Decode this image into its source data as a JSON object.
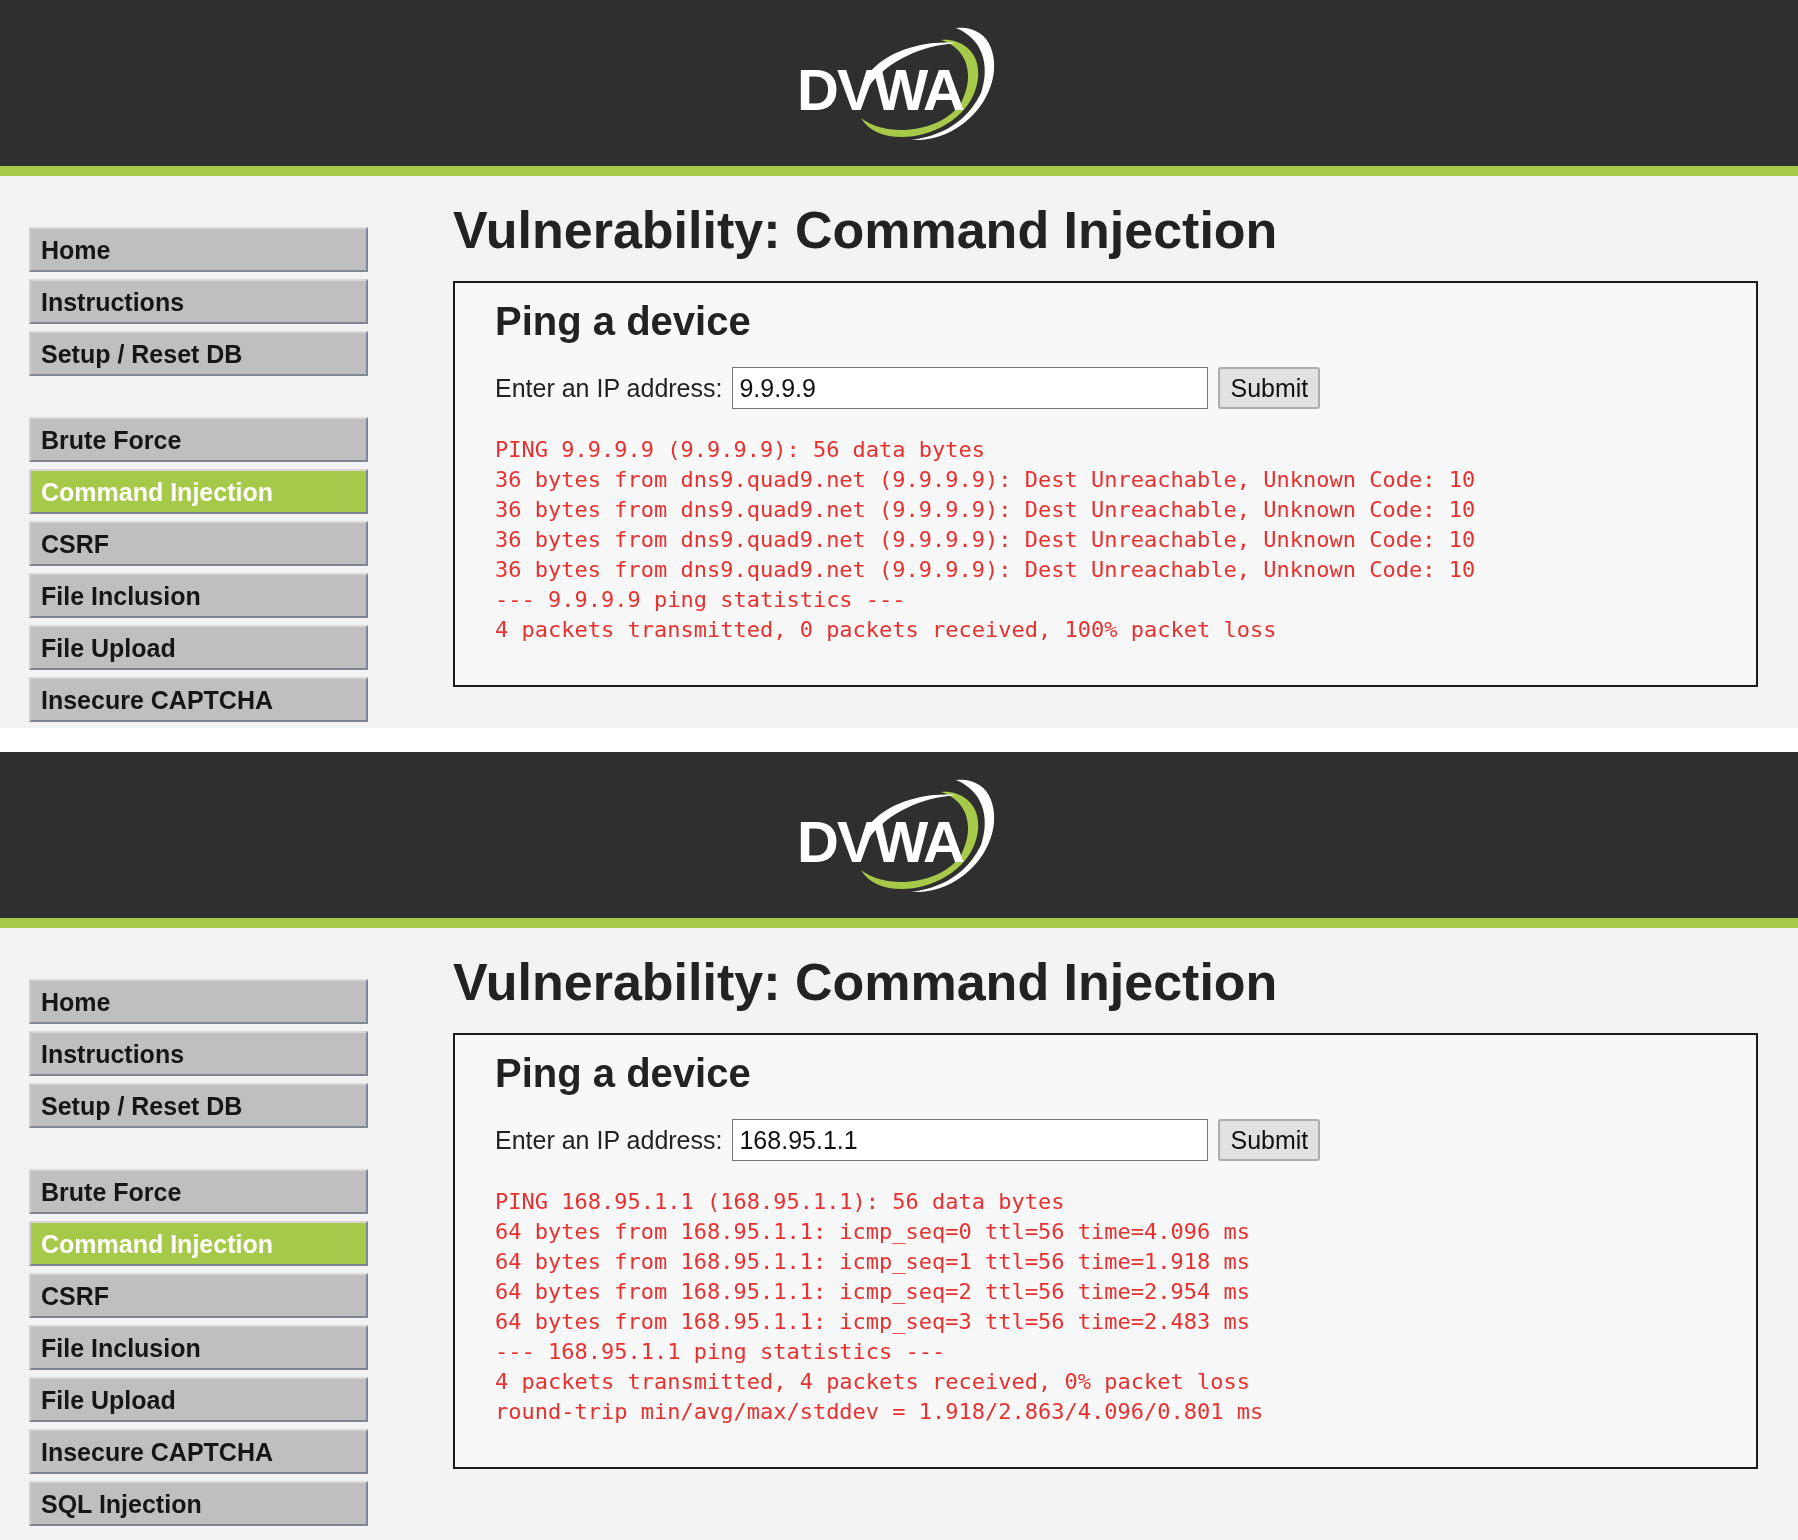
{
  "panels": [
    {
      "logo": "DVWA",
      "menu_groups": [
        [
          {
            "label": "Home",
            "selected": false
          },
          {
            "label": "Instructions",
            "selected": false
          },
          {
            "label": "Setup / Reset DB",
            "selected": false
          }
        ],
        [
          {
            "label": "Brute Force",
            "selected": false
          },
          {
            "label": "Command Injection",
            "selected": true
          },
          {
            "label": "CSRF",
            "selected": false
          },
          {
            "label": "File Inclusion",
            "selected": false
          },
          {
            "label": "File Upload",
            "selected": false
          },
          {
            "label": "Insecure CAPTCHA",
            "selected": false
          }
        ]
      ],
      "heading": "Vulnerability: Command Injection",
      "form": {
        "title": "Ping a device",
        "label": "Enter an IP address:",
        "value": "9.9.9.9",
        "button": "Submit"
      },
      "output": [
        "PING 9.9.9.9 (9.9.9.9): 56 data bytes",
        "36 bytes from dns9.quad9.net (9.9.9.9): Dest Unreachable, Unknown Code: 10",
        "36 bytes from dns9.quad9.net (9.9.9.9): Dest Unreachable, Unknown Code: 10",
        "36 bytes from dns9.quad9.net (9.9.9.9): Dest Unreachable, Unknown Code: 10",
        "36 bytes from dns9.quad9.net (9.9.9.9): Dest Unreachable, Unknown Code: 10",
        "--- 9.9.9.9 ping statistics ---",
        "4 packets transmitted, 0 packets received, 100% packet loss"
      ]
    },
    {
      "logo": "DVWA",
      "menu_groups": [
        [
          {
            "label": "Home",
            "selected": false
          },
          {
            "label": "Instructions",
            "selected": false
          },
          {
            "label": "Setup / Reset DB",
            "selected": false
          }
        ],
        [
          {
            "label": "Brute Force",
            "selected": false
          },
          {
            "label": "Command Injection",
            "selected": true
          },
          {
            "label": "CSRF",
            "selected": false
          },
          {
            "label": "File Inclusion",
            "selected": false
          },
          {
            "label": "File Upload",
            "selected": false
          },
          {
            "label": "Insecure CAPTCHA",
            "selected": false
          },
          {
            "label": "SQL Injection",
            "selected": false
          }
        ]
      ],
      "heading": "Vulnerability: Command Injection",
      "form": {
        "title": "Ping a device",
        "label": "Enter an IP address:",
        "value": "168.95.1.1",
        "button": "Submit"
      },
      "output": [
        "PING 168.95.1.1 (168.95.1.1): 56 data bytes",
        "64 bytes from 168.95.1.1: icmp_seq=0 ttl=56 time=4.096 ms",
        "64 bytes from 168.95.1.1: icmp_seq=1 ttl=56 time=1.918 ms",
        "64 bytes from 168.95.1.1: icmp_seq=2 ttl=56 time=2.954 ms",
        "64 bytes from 168.95.1.1: icmp_seq=3 ttl=56 time=2.483 ms",
        "--- 168.95.1.1 ping statistics ---",
        "4 packets transmitted, 4 packets received, 0% packet loss",
        "round-trip min/avg/max/stddev = 1.918/2.863/4.096/0.801 ms"
      ]
    }
  ]
}
